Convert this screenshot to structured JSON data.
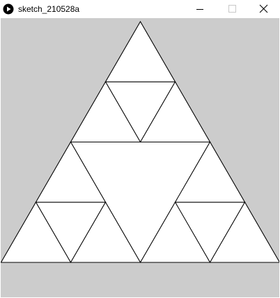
{
  "window": {
    "title": "sketch_210528a",
    "icons": {
      "app": "processing-play-icon",
      "minimize": "minimize-icon",
      "maximize": "maximize-icon",
      "close": "close-icon"
    }
  },
  "canvas": {
    "background_color": "#cccccc",
    "fill_color": "#ffffff",
    "stroke_color": "#000000",
    "content": "sierpinski-triangle",
    "depth": 2
  }
}
